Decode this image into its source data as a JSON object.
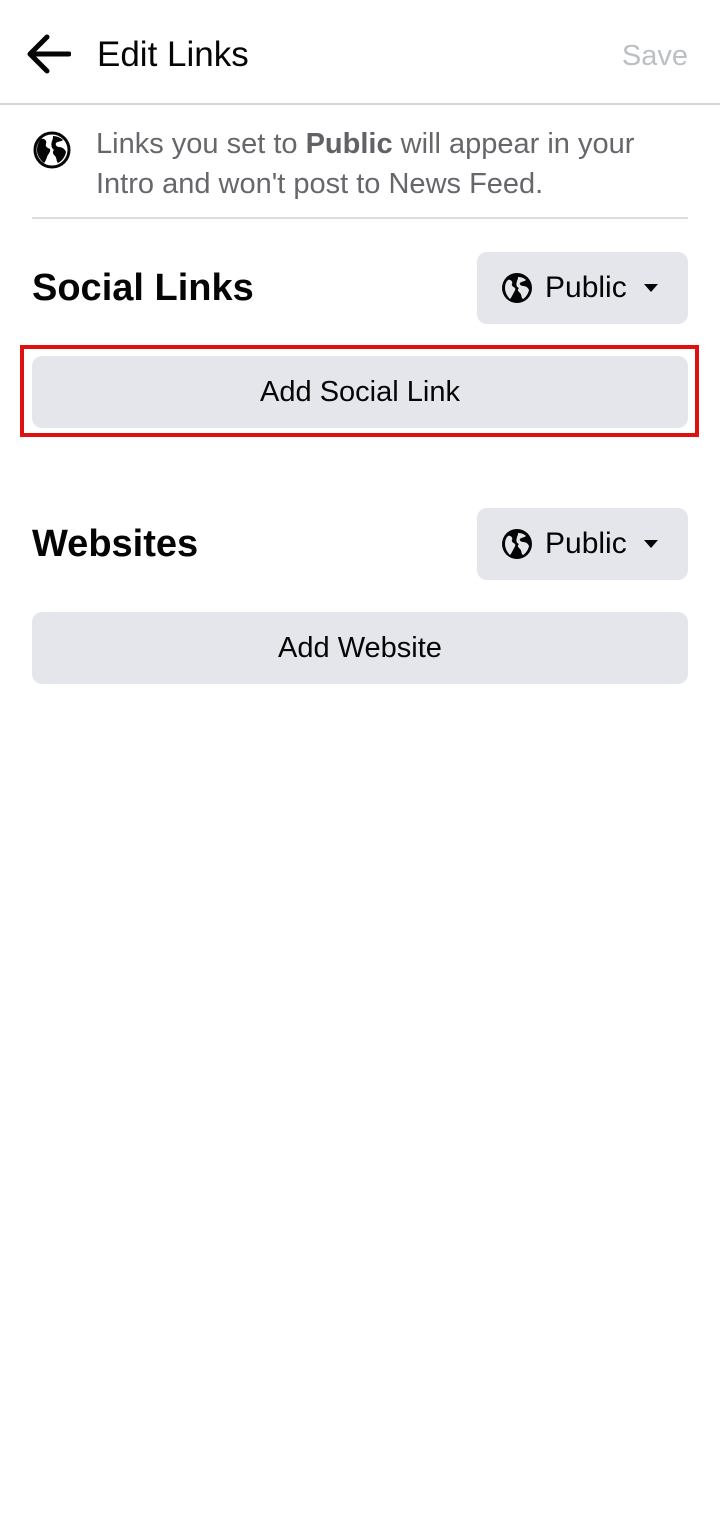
{
  "header": {
    "title": "Edit Links",
    "save_label": "Save",
    "back_icon": "arrow-left-icon"
  },
  "notice": {
    "icon": "globe-icon",
    "text_before": "Links you set to ",
    "text_bold": "Public",
    "text_after": " will appear in your Intro and won't post to News Feed."
  },
  "social_links": {
    "title": "Social Links",
    "privacy_label": "Public",
    "add_label": "Add Social Link"
  },
  "websites": {
    "title": "Websites",
    "privacy_label": "Public",
    "add_label": "Add Website"
  },
  "colors": {
    "button_bg": "#e4e6eb",
    "muted_text": "#65676b",
    "save_disabled": "#bcc0c4",
    "highlight": "#e01010"
  }
}
